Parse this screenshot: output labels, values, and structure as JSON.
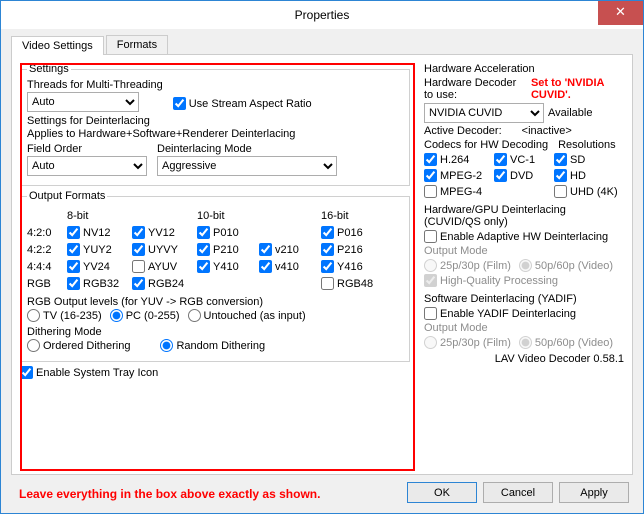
{
  "window": {
    "title": "Properties"
  },
  "tabs": [
    "Video Settings",
    "Formats"
  ],
  "settings": {
    "legend": "Settings",
    "threads_label": "Threads for Multi-Threading",
    "threads_value": "Auto",
    "stream_aspect": "Use Stream Aspect Ratio",
    "deint_desc1": "Settings for Deinterlacing",
    "deint_desc2": "Applies to Hardware+Software+Renderer Deinterlacing",
    "field_order_label": "Field Order",
    "field_order_value": "Auto",
    "deint_mode_label": "Deinterlacing Mode",
    "deint_mode_value": "Aggressive"
  },
  "output": {
    "legend": "Output Formats",
    "hdr": [
      "8-bit",
      "",
      "10-bit",
      "",
      "16-bit"
    ],
    "rows": [
      {
        "k": "4:2:0",
        "c": [
          [
            "NV12",
            true
          ],
          [
            "YV12",
            true
          ],
          [
            "P010",
            true
          ],
          [
            "",
            null
          ],
          [
            "P016",
            true
          ]
        ]
      },
      {
        "k": "4:2:2",
        "c": [
          [
            "YUY2",
            true
          ],
          [
            "UYVY",
            true
          ],
          [
            "P210",
            true
          ],
          [
            "v210",
            true
          ],
          [
            "P216",
            true
          ]
        ]
      },
      {
        "k": "4:4:4",
        "c": [
          [
            "YV24",
            true
          ],
          [
            "AYUV",
            false
          ],
          [
            "Y410",
            true
          ],
          [
            "v410",
            true
          ],
          [
            "Y416",
            true
          ]
        ]
      },
      {
        "k": "RGB",
        "c": [
          [
            "RGB32",
            true
          ],
          [
            "RGB24",
            true
          ],
          [
            "",
            null
          ],
          [
            "",
            null
          ],
          [
            "RGB48",
            false
          ]
        ]
      }
    ],
    "rgb_levels_label": "RGB Output levels (for YUV -> RGB conversion)",
    "rgb_levels": [
      "TV (16-235)",
      "PC (0-255)",
      "Untouched (as input)"
    ],
    "rgb_selected": 1,
    "dither_label": "Dithering Mode",
    "dither": [
      "Ordered Dithering",
      "Random Dithering"
    ],
    "dither_selected": 1
  },
  "tray": "Enable System Tray Icon",
  "right": {
    "hw_accel": "Hardware Acceleration",
    "hw_decoder_label": "Hardware Decoder to use:",
    "set_to": "Set to 'NVIDIA CUVID'.",
    "decoder_value": "NVIDIA CUVID",
    "avail": "Available",
    "active_decoder_label": "Active Decoder:",
    "active_decoder_value": "<inactive>",
    "codecs_label": "Codecs for HW Decoding",
    "res_label": "Resolutions",
    "codecs": [
      [
        "H.264",
        true
      ],
      [
        "VC-1",
        true
      ],
      [
        "SD",
        true
      ],
      [
        "MPEG-2",
        true
      ],
      [
        "DVD",
        true
      ],
      [
        "HD",
        true
      ],
      [
        "MPEG-4",
        false
      ],
      [
        "",
        null
      ],
      [
        "UHD (4K)",
        false
      ]
    ],
    "hw_deint_label": "Hardware/GPU Deinterlacing (CUVID/QS only)",
    "hw_deint_enable": "Enable Adaptive HW Deinterlacing",
    "output_mode_label": "Output Mode",
    "modes": [
      "25p/30p (Film)",
      "50p/60p (Video)"
    ],
    "hw_selected": 1,
    "hq": "High-Quality Processing",
    "yadif_label": "Software Deinterlacing (YADIF)",
    "yadif_enable": "Enable YADIF Deinterlacing",
    "yadif_selected": 1,
    "version": "LAV Video Decoder 0.58.1"
  },
  "buttons": {
    "ok": "OK",
    "cancel": "Cancel",
    "apply": "Apply"
  },
  "footer": "Leave everything in the box above exactly as shown."
}
